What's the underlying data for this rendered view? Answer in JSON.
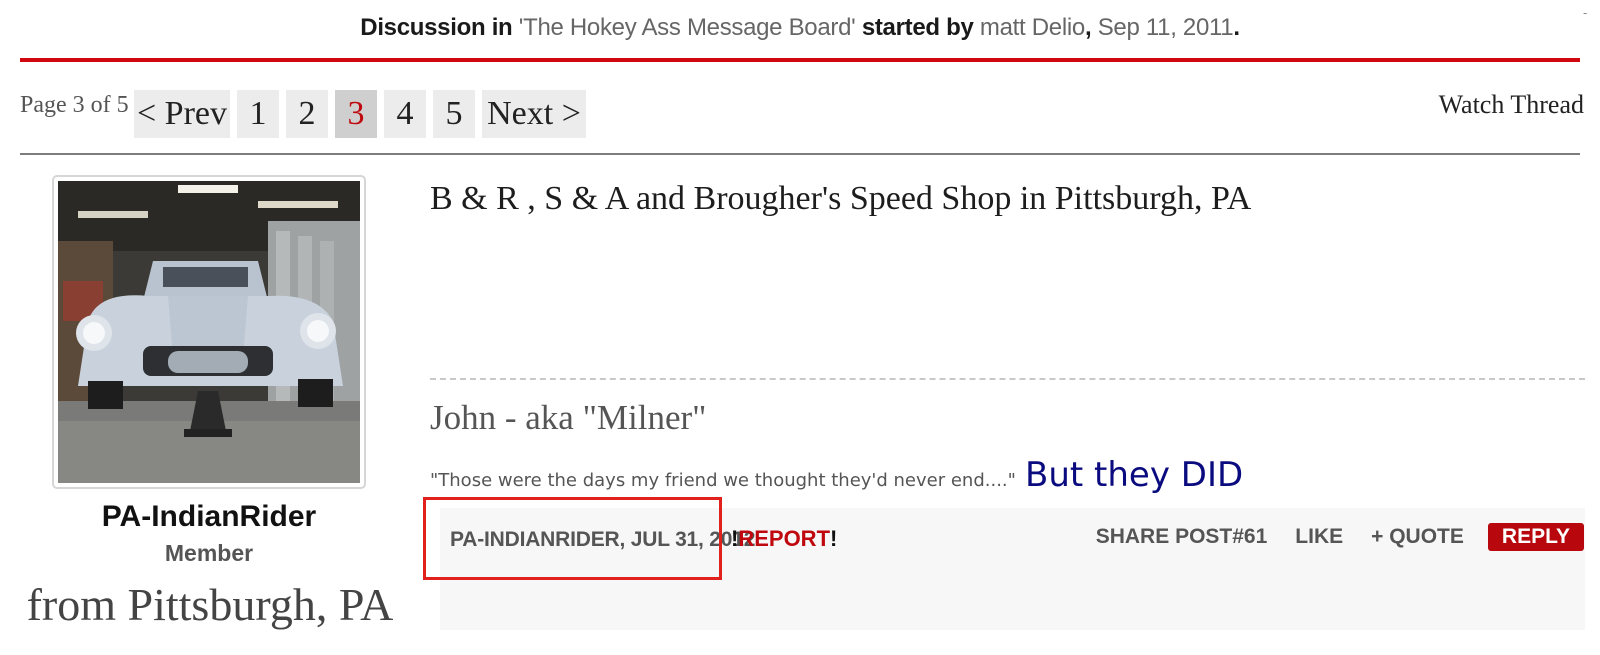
{
  "discussion": {
    "prefix": "Discussion in",
    "forum": "'The Hokey Ass Message Board'",
    "started_by": "started by",
    "author": "matt Delio",
    "date": "Sep 11, 2011",
    "period": "."
  },
  "corner_mark": "-",
  "pagination": {
    "label": "Page 3 of 5",
    "prev": "< Prev",
    "pages": [
      "1",
      "2",
      "3",
      "4",
      "5"
    ],
    "current": "3",
    "next": "Next >"
  },
  "watch_thread": "Watch Thread",
  "user": {
    "name": "PA-IndianRider",
    "title": "Member",
    "location": "from Pittsburgh, PA",
    "avatar_icon": "car-avatar-photo"
  },
  "post": {
    "message": "B & R , S & A and Brougher's Speed Shop in Pittsburgh, PA",
    "signature_name": "John - aka \"Milner\"",
    "signature_quote": "\"Those were the days my friend we thought they'd never end....\"",
    "signature_big": "But they DID",
    "meta": "PA-INDIANRIDER, JUL 31, 2012",
    "report_prefix": "!",
    "report_label": "REPORT",
    "report_suffix": "!",
    "share": "SHARE POST#61",
    "like": "LIKE",
    "quote": "+ QUOTE",
    "reply": "REPLY"
  },
  "colors": {
    "accent_red": "#d1080f",
    "signature_blue": "#0b0b80"
  }
}
